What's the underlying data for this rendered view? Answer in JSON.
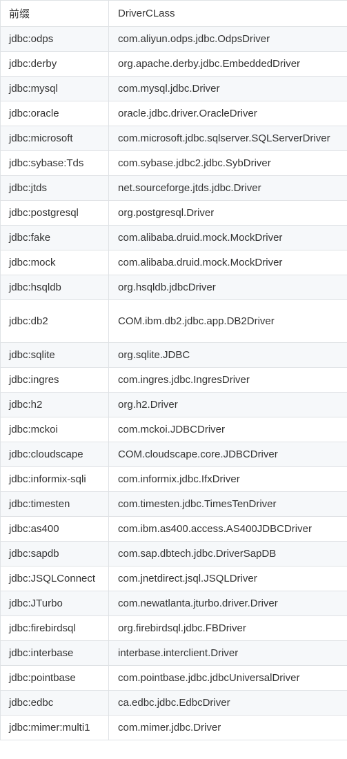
{
  "table": {
    "headers": [
      "前缀",
      "DriverCLass"
    ],
    "rows": [
      [
        "jdbc:odps",
        "com.aliyun.odps.jdbc.OdpsDriver"
      ],
      [
        "jdbc:derby",
        "org.apache.derby.jdbc.EmbeddedDriver"
      ],
      [
        "jdbc:mysql",
        "com.mysql.jdbc.Driver"
      ],
      [
        "jdbc:oracle",
        "oracle.jdbc.driver.OracleDriver"
      ],
      [
        "jdbc:microsoft",
        "com.microsoft.jdbc.sqlserver.SQLServerDriver"
      ],
      [
        "jdbc:sybase:Tds",
        "com.sybase.jdbc2.jdbc.SybDriver"
      ],
      [
        "jdbc:jtds",
        "net.sourceforge.jtds.jdbc.Driver"
      ],
      [
        "jdbc:postgresql",
        "org.postgresql.Driver"
      ],
      [
        "jdbc:fake",
        "com.alibaba.druid.mock.MockDriver"
      ],
      [
        "jdbc:mock",
        "com.alibaba.druid.mock.MockDriver"
      ],
      [
        "jdbc:hsqldb",
        "org.hsqldb.jdbcDriver"
      ],
      [
        "jdbc:db2",
        "COM.ibm.db2.jdbc.app.DB2Driver"
      ],
      [
        "jdbc:sqlite",
        "org.sqlite.JDBC"
      ],
      [
        "jdbc:ingres",
        "com.ingres.jdbc.IngresDriver"
      ],
      [
        "jdbc:h2",
        "org.h2.Driver"
      ],
      [
        "jdbc:mckoi",
        "com.mckoi.JDBCDriver"
      ],
      [
        "jdbc:cloudscape",
        "COM.cloudscape.core.JDBCDriver"
      ],
      [
        "jdbc:informix-sqli",
        "com.informix.jdbc.IfxDriver"
      ],
      [
        "jdbc:timesten",
        "com.timesten.jdbc.TimesTenDriver"
      ],
      [
        "jdbc:as400",
        "com.ibm.as400.access.AS400JDBCDriver"
      ],
      [
        "jdbc:sapdb",
        "com.sap.dbtech.jdbc.DriverSapDB"
      ],
      [
        "jdbc:JSQLConnect",
        "com.jnetdirect.jsql.JSQLDriver"
      ],
      [
        "jdbc:JTurbo",
        "com.newatlanta.jturbo.driver.Driver"
      ],
      [
        "jdbc:firebirdsql",
        "org.firebirdsql.jdbc.FBDriver"
      ],
      [
        "jdbc:interbase",
        "interbase.interclient.Driver"
      ],
      [
        "jdbc:pointbase",
        "com.pointbase.jdbc.jdbcUniversalDriver"
      ],
      [
        "jdbc:edbc",
        "ca.edbc.jdbc.EdbcDriver"
      ],
      [
        "jdbc:mimer:multi1",
        "com.mimer.jdbc.Driver"
      ]
    ]
  }
}
